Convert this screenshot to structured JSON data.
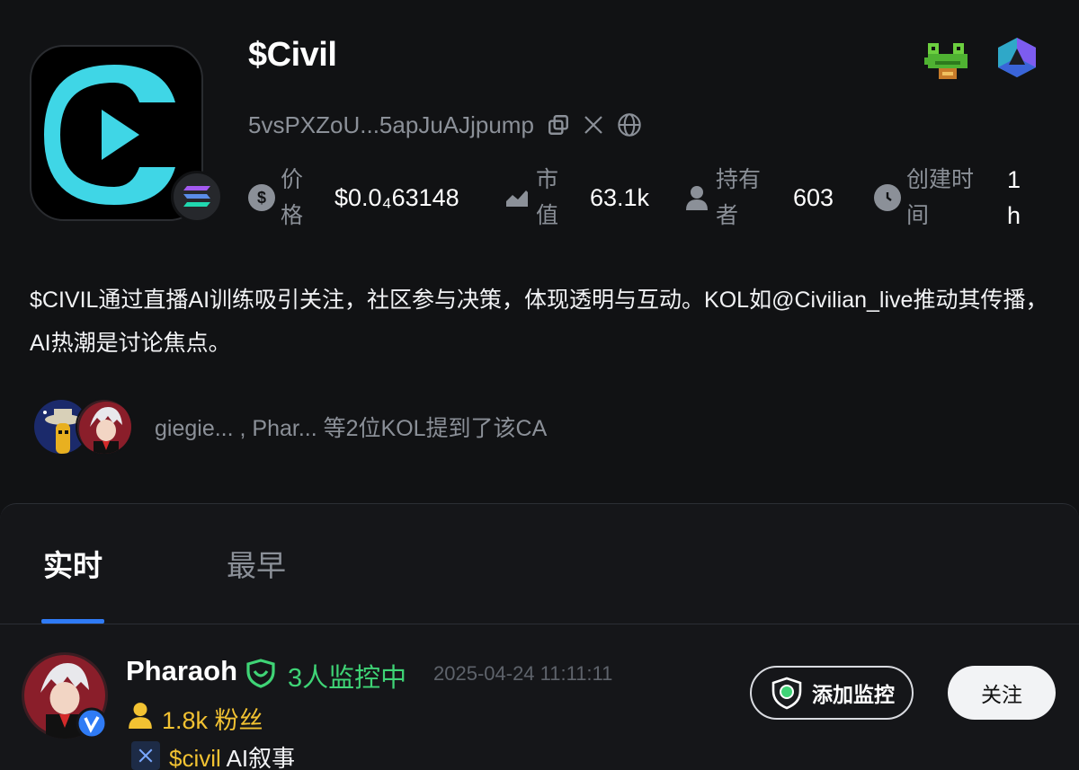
{
  "token": {
    "name": "$Civil",
    "contract": "5vsPXZoU...5apJuAJjpump"
  },
  "stats": [
    {
      "label": "价格",
      "value": "$0.0₄63148",
      "icon": "dollar-icon"
    },
    {
      "label": "市值",
      "value": "63.1k",
      "icon": "chart-icon"
    },
    {
      "label": "持有者",
      "value": "603",
      "icon": "user-icon"
    },
    {
      "label": "创建时间",
      "value": "1h",
      "icon": "clock-icon"
    }
  ],
  "description": "$CIVIL通过直播AI训练吸引关注，社区参与决策，体现透明与互动。KOL如@Civilian_live推动其传播，AI热潮是讨论焦点。",
  "kol_mention": "giegie... , Phar... 等2位KOL提到了该CA",
  "tabs": [
    "实时",
    "最早"
  ],
  "post": {
    "author": "Pharaoh",
    "monitor_count": "3人监控中",
    "time": "2025-04-24 11:11:11",
    "fans": "1.8k 粉丝",
    "tag_ticker": "$civil",
    "tag_text": " AI叙事",
    "monitor_button": "添加监控",
    "follow_button": "关注"
  },
  "colors": {
    "background": "#111214",
    "accent_green": "#3fd476",
    "accent_gold": "#f2c232",
    "tab_underline": "#2f7bf5",
    "logo_cyan": "#3fd6e6"
  }
}
